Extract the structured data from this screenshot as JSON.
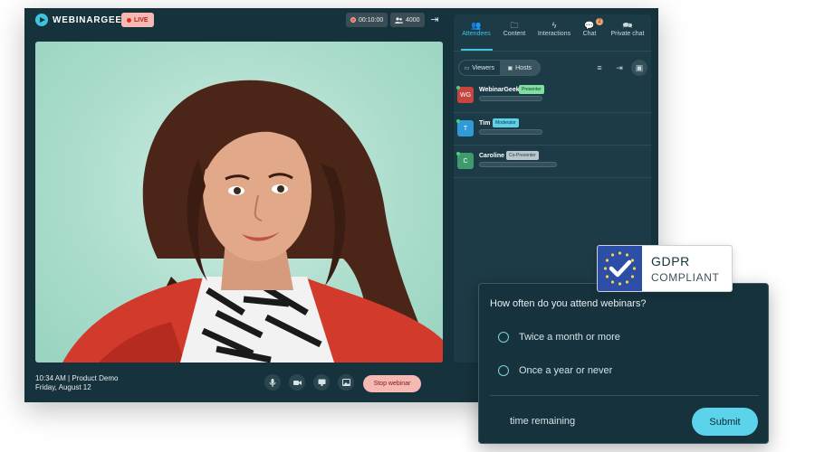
{
  "brand": {
    "logo_text": "WEBINARGEEK",
    "accent": "#3cc5dd"
  },
  "header": {
    "live_label": "LIVE",
    "timer": "00:10:00",
    "viewer_count": "4000"
  },
  "footer": {
    "time_line": "10:34 AM | Product Demo",
    "date_line": "Friday, August 12",
    "stop_label": "Stop webinar",
    "controls": [
      "microphone-icon",
      "camera-icon",
      "screen-share-icon",
      "media-icon"
    ]
  },
  "panel": {
    "tabs": [
      {
        "label": "Attendees",
        "icon": "attendees-icon",
        "active": true
      },
      {
        "label": "Content",
        "icon": "folder-icon"
      },
      {
        "label": "Interactions",
        "icon": "lightning-icon"
      },
      {
        "label": "Chat",
        "icon": "chat-icon",
        "badge": "2"
      },
      {
        "label": "Private chat",
        "icon": "private-chat-icon"
      }
    ],
    "segments": {
      "viewers": "Viewers",
      "hosts": "Hosts",
      "selected": "Hosts"
    },
    "hosts": [
      {
        "initials": "WG",
        "name": "WebinarGeek",
        "role": "Presenter",
        "avatar_color": "#c8443f",
        "role_bg": "#7fe0a0",
        "role_color": "#0f3b23"
      },
      {
        "initials": "T",
        "name": "Tim",
        "role": "Moderator",
        "avatar_color": "#2f9ad6",
        "role_bg": "#5fd0e8",
        "role_color": "#0b3340"
      },
      {
        "initials": "C",
        "name": "Caroline",
        "role": "Co-Presenter",
        "avatar_color": "#3f9a6c",
        "role_bg": "#b9c7cc",
        "role_color": "#1d3b46"
      }
    ]
  },
  "gdpr": {
    "title": "GDPR",
    "subtitle": "COMPLIANT"
  },
  "poll": {
    "question": "How often do you attend webinars?",
    "options": [
      "Twice a month or more",
      "Once a year or never"
    ],
    "time_remaining": "time remaining",
    "submit_label": "Submit"
  }
}
